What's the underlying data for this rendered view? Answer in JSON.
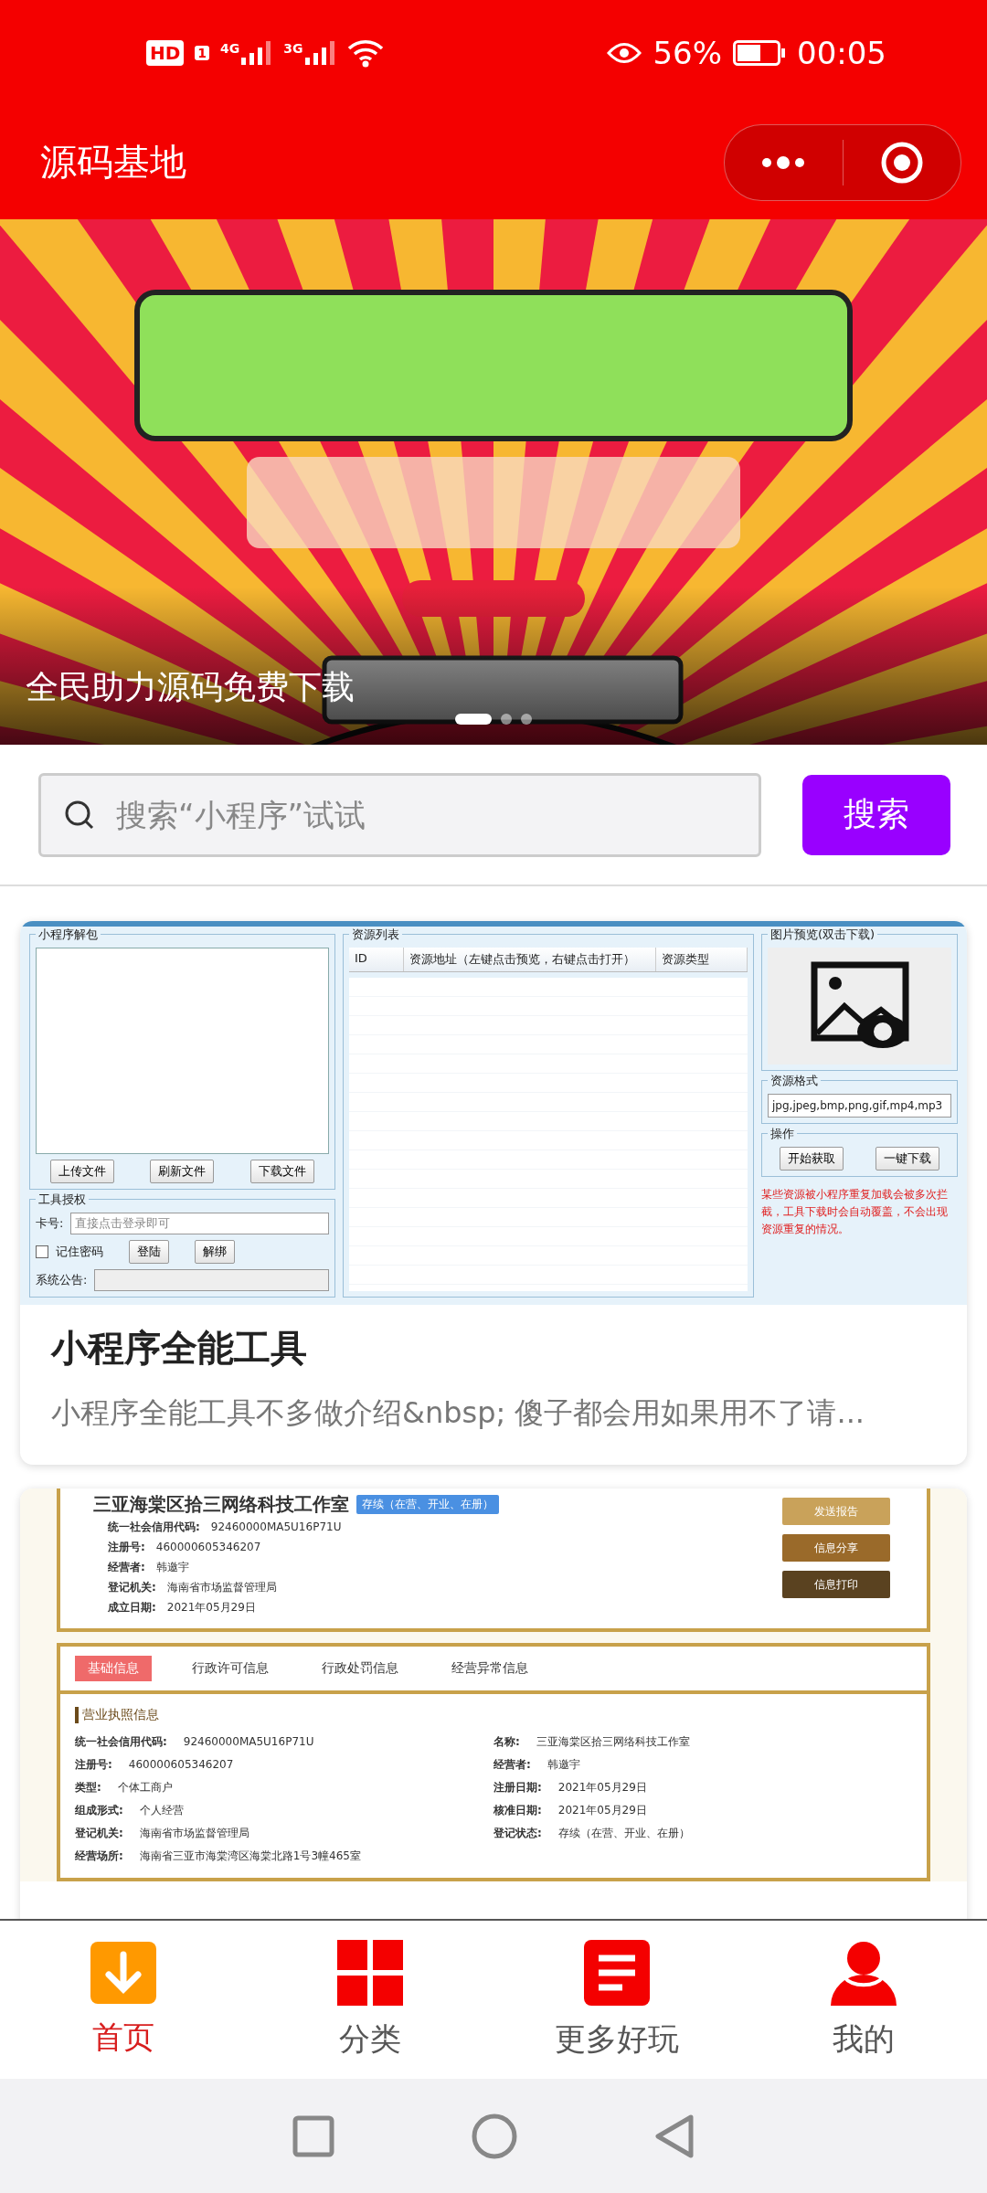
{
  "status_bar": {
    "hd_badge": "HD",
    "sim_number": "1",
    "networks": [
      "4G",
      "3G"
    ],
    "battery": "56%",
    "time": "00:05"
  },
  "app_bar": {
    "title": "源码基地"
  },
  "banner": {
    "caption": "全民助力源码免费下载",
    "pages": [
      {
        "selected": true
      },
      {
        "selected": false
      },
      {
        "selected": false
      }
    ]
  },
  "search": {
    "placeholder": "搜索“小程序”试试",
    "button": "搜索"
  },
  "articles": [
    {
      "kind": "tool",
      "title": "小程序全能工具",
      "description": "小程序全能工具不多做介绍&nbsp; 傻子都会用如果用不了请...",
      "thumbnail": {
        "unpack_group": "小程序解包",
        "unpack_buttons": [
          "上传文件",
          "刷新文件",
          "下载文件"
        ],
        "auth_group": "工具授权",
        "card_label": "卡号:",
        "card_placeholder": "直接点击登录即可",
        "remember": {
          "label": "记住密码",
          "checked": false
        },
        "auth_buttons": [
          "登陆",
          "解绑"
        ],
        "notice_label": "系统公告:",
        "list_group": "资源列表",
        "list_columns": [
          "ID",
          "资源地址（左键点击预览，右键点击打开）",
          "资源类型"
        ],
        "preview_group": "图片预览(双击下载)",
        "format_group": "资源格式",
        "formats": "jpg,jpeg,bmp,png,gif,mp4,mp3",
        "ops_group": "操作",
        "ops_buttons": [
          "开始获取",
          "一键下载"
        ],
        "warning": "某些资源被小程序重复加载会被多次拦截，工具下载时会自动覆盖，不会出现资源重复的情况。"
      }
    },
    {
      "kind": "license",
      "thumbnail": {
        "company": "三亚海棠区拾三网络科技工作室",
        "status_tag": "存续（在营、开业、在册）",
        "summary": [
          {
            "key": "统一社会信用代码:",
            "value": "92460000MA5U16P71U"
          },
          {
            "key": "注册号:",
            "value": "460000605346207"
          },
          {
            "key": "经营者:",
            "value": "韩邀宇"
          },
          {
            "key": "登记机关:",
            "value": "海南省市场监督管理局"
          },
          {
            "key": "成立日期:",
            "value": "2021年05月29日"
          }
        ],
        "actions": [
          "发送报告",
          "信息分享",
          "信息打印"
        ],
        "tabs": [
          {
            "label": "基础信息",
            "selected": true
          },
          {
            "label": "行政许可信息",
            "selected": false
          },
          {
            "label": "行政处罚信息",
            "selected": false
          },
          {
            "label": "经营异常信息",
            "selected": false
          }
        ],
        "section": "营业执照信息",
        "left_fields": [
          {
            "key": "统一社会信用代码:",
            "value": "92460000MA5U16P71U"
          },
          {
            "key": "注册号:",
            "value": "460000605346207"
          },
          {
            "key": "类型:",
            "value": "个体工商户"
          },
          {
            "key": "组成形式:",
            "value": "个人经营"
          },
          {
            "key": "登记机关:",
            "value": "海南省市场监督管理局"
          },
          {
            "key": "经营场所:",
            "value": "海南省三亚市海棠湾区海棠北路1号3幢465室"
          }
        ],
        "right_fields": [
          {
            "key": "名称:",
            "value": "三亚海棠区拾三网络科技工作室"
          },
          {
            "key": "经营者:",
            "value": "韩邀宇"
          },
          {
            "key": "注册日期:",
            "value": "2021年05月29日"
          },
          {
            "key": "核准日期:",
            "value": "2021年05月29日"
          },
          {
            "key": "登记状态:",
            "value": "存续（在营、开业、在册）"
          }
        ]
      }
    }
  ],
  "tab_bar": [
    {
      "kind": "home",
      "label": "首页",
      "selected": true
    },
    {
      "kind": "category",
      "label": "分类",
      "selected": false
    },
    {
      "kind": "more",
      "label": "更多好玩",
      "selected": false
    },
    {
      "kind": "profile",
      "label": "我的",
      "selected": false
    }
  ]
}
